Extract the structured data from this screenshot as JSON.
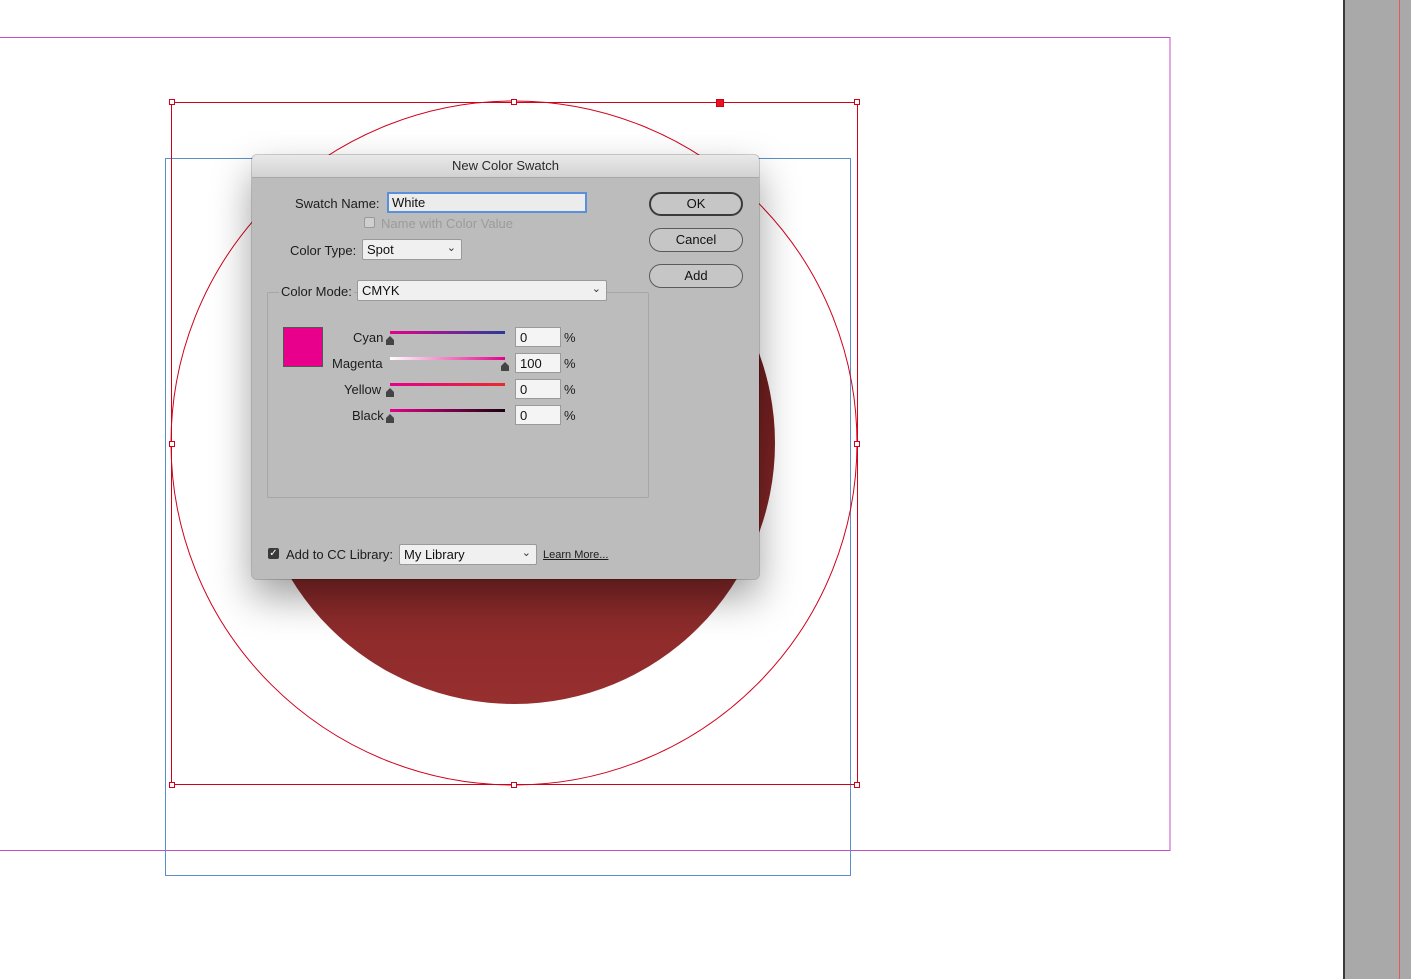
{
  "dialog": {
    "title": "New Color Swatch",
    "swatch_name_label": "Swatch Name:",
    "swatch_name_value": "White",
    "name_with_color_value_label": "Name with Color Value",
    "color_type_label": "Color Type:",
    "color_type_value": "Spot",
    "color_mode_label": "Color Mode:",
    "color_mode_value": "CMYK",
    "preview_color": "#e8008c",
    "sliders": [
      {
        "label": "Cyan",
        "value": "0",
        "unit": "%",
        "level": 0
      },
      {
        "label": "Magenta",
        "value": "100",
        "unit": "%",
        "level": 100
      },
      {
        "label": "Yellow",
        "value": "0",
        "unit": "%",
        "level": 0
      },
      {
        "label": "Black",
        "value": "0",
        "unit": "%",
        "level": 0
      }
    ],
    "buttons": {
      "ok": "OK",
      "cancel": "Cancel",
      "add": "Add"
    },
    "cc_library_label": "Add to CC Library:",
    "cc_library_value": "My Library",
    "learn_more": "Learn More...",
    "cc_library_checked": true
  },
  "colors": {
    "artwork_circle": "#912b2b",
    "selection": "#d0021b",
    "margin_guide": "#c44fc4",
    "bleed_guide": "#5b8fc7"
  }
}
